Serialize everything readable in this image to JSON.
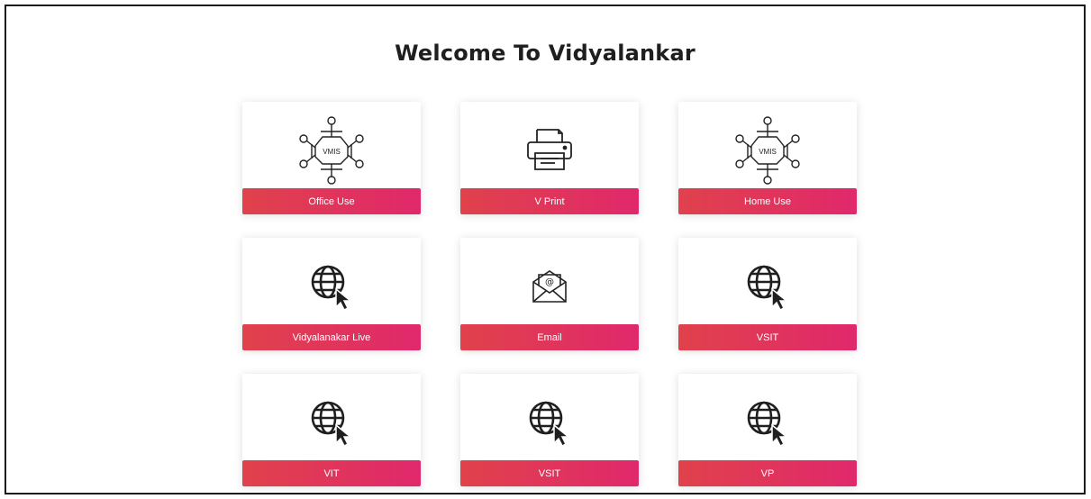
{
  "title": "Welcome To Vidyalankar",
  "cards": [
    {
      "label": "Office Use",
      "icon": "vmis-network-icon",
      "icon_text": "VMIS"
    },
    {
      "label": "V Print",
      "icon": "printer-icon"
    },
    {
      "label": "Home Use",
      "icon": "vmis-network-icon",
      "icon_text": "VMIS"
    },
    {
      "label": "Vidyalanakar Live",
      "icon": "globe-cursor-icon"
    },
    {
      "label": "Email",
      "icon": "email-envelope-icon"
    },
    {
      "label": "VSIT",
      "icon": "globe-cursor-icon"
    },
    {
      "label": "VIT",
      "icon": "globe-cursor-icon"
    },
    {
      "label": "VSIT",
      "icon": "globe-cursor-icon"
    },
    {
      "label": "VP",
      "icon": "globe-cursor-icon"
    }
  ],
  "colors": {
    "label_gradient_start": "#e0424b",
    "label_gradient_end": "#e0286c"
  }
}
